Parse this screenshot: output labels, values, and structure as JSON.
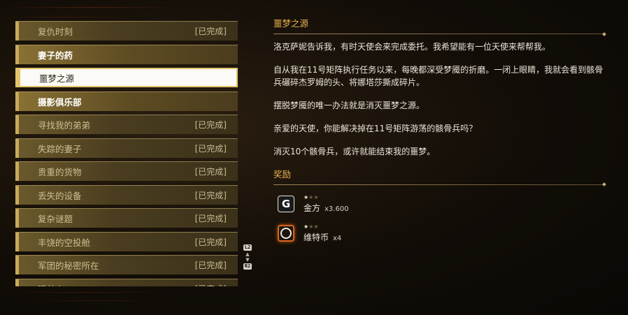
{
  "quest_list": [
    {
      "title": "复仇时刻",
      "status": "[已完成]",
      "state": "done"
    },
    {
      "title": "妻子的药",
      "status": "",
      "state": "open"
    },
    {
      "title": "噩梦之源",
      "status": "",
      "state": "selected"
    },
    {
      "title": "摄影俱乐部",
      "status": "",
      "state": "open"
    },
    {
      "title": "寻找我的弟弟",
      "status": "[已完成]",
      "state": "done"
    },
    {
      "title": "失踪的妻子",
      "status": "[已完成]",
      "state": "done"
    },
    {
      "title": "贵重的货物",
      "status": "[已完成]",
      "state": "done"
    },
    {
      "title": "丢失的设备",
      "status": "[已完成]",
      "state": "done"
    },
    {
      "title": "复杂谜题",
      "status": "[已完成]",
      "state": "done"
    },
    {
      "title": "丰饶的空投舱",
      "status": "[已完成]",
      "state": "done"
    },
    {
      "title": "军团的秘密所在",
      "status": "[已完成]",
      "state": "done"
    },
    {
      "title": "睡美人",
      "status": "[已完成]",
      "state": "done"
    }
  ],
  "scroll": {
    "up_hint": "L2",
    "down_hint": "R2"
  },
  "detail": {
    "title": "噩梦之源",
    "paragraphs": [
      "洛克萨妮告诉我，有时天使会来完成委托。我希望能有一位天使来帮帮我。",
      "自从我在11号矩阵执行任务以来，每晚都深受梦魇的折磨。一闭上眼睛，我就会看到骸骨兵碾碎杰罗姆的头、将娜塔莎撕成碎片。",
      "摆脱梦魇的唯一办法就是消灭噩梦之源。",
      "亲爱的天使，你能解决掉在11号矩阵游荡的骸骨兵吗？",
      "消灭10个骸骨兵，或许就能结束我的噩梦。"
    ],
    "rewards_title": "奖励",
    "rewards": [
      {
        "name": "金方",
        "qty": "x3.600",
        "icon": "G",
        "icon_name": "gold-currency-icon",
        "stars": 1,
        "max_stars": 3
      },
      {
        "name": "维特币",
        "qty": "x4",
        "icon": "",
        "icon_name": "vita-coin-icon",
        "stars": 1,
        "max_stars": 3
      }
    ]
  },
  "colors": {
    "accent": "#e8b150",
    "list_gold": "#c9a95a",
    "selected_bg": "#fbfaf6",
    "coin_glow": "#d8641c"
  }
}
